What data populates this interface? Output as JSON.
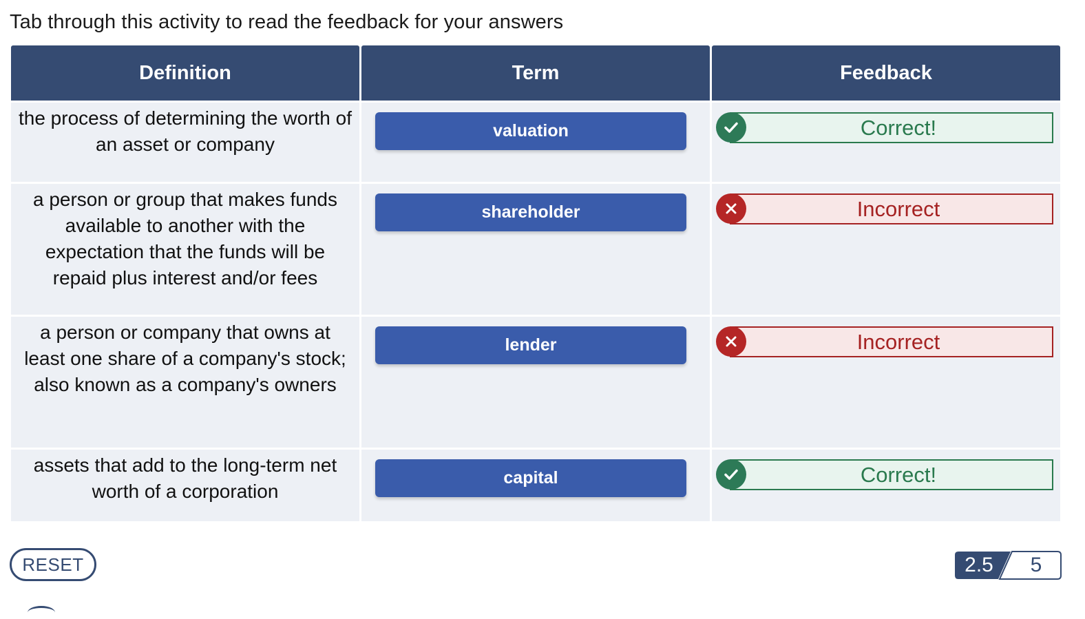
{
  "instructions": "Tab through this activity to read the feedback for your answers",
  "headers": {
    "definition": "Definition",
    "term": "Term",
    "feedback": "Feedback"
  },
  "rows": [
    {
      "definition": "the process of determining the worth of an asset or company",
      "term": "valuation",
      "feedback": "Correct!",
      "status": "correct"
    },
    {
      "definition": "a person or group that makes funds available to another with the expectation that the funds will be repaid plus interest and/or fees",
      "term": "shareholder",
      "feedback": "Incorrect",
      "status": "incorrect"
    },
    {
      "definition": "a person or company that owns at least one share of a company's stock; also known as a company's owners",
      "term": "lender",
      "feedback": "Incorrect",
      "status": "incorrect"
    },
    {
      "definition": "assets that add to the long-term net worth of a corporation",
      "term": "capital",
      "feedback": "Correct!",
      "status": "correct"
    }
  ],
  "reset_label": "RESET",
  "score": {
    "earned": "2.5",
    "total": "5"
  },
  "colors": {
    "header": "#354b72",
    "term_button": "#3a5cab",
    "correct": "#2a7a4e",
    "incorrect": "#a52222",
    "cell_bg": "#edf0f5"
  },
  "icons": {
    "correct": "check-circle-icon",
    "incorrect": "x-circle-icon"
  }
}
